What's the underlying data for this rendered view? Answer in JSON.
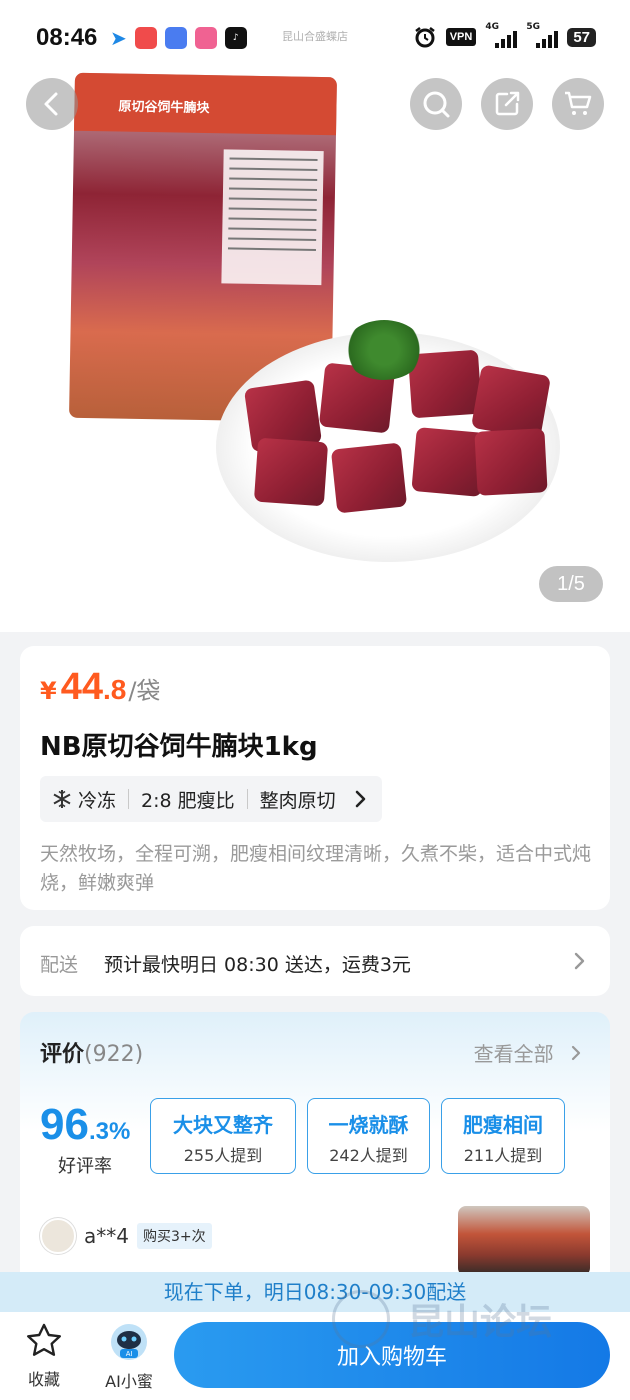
{
  "status_bar": {
    "time": "08:46",
    "carrier_text": "昆山合盛蝶店",
    "vpn": "VPN",
    "net1": "4G",
    "net2": "5G",
    "battery": "57"
  },
  "gallery": {
    "package_text": "原切谷饲牛腩块",
    "counter": "1/5"
  },
  "product": {
    "price_symbol": "¥",
    "price_int": "44",
    "price_dec": ".8",
    "price_unit": "/袋",
    "title": "NB原切谷饲牛腩块1kg",
    "tags": [
      "冷冻",
      "2:8 肥瘦比",
      "整肉原切"
    ],
    "description": "天然牧场，全程可溯，肥瘦相间纹理清晰，久煮不柴，适合中式炖烧，鲜嫩爽弹"
  },
  "delivery": {
    "label": "配送",
    "text": "预计最快明日 08:30 送达，运费3元"
  },
  "reviews": {
    "title": "评价",
    "count": "(922)",
    "view_all": "查看全部",
    "rate_big": "96",
    "rate_small": ".3%",
    "rate_label": "好评率",
    "chips": [
      {
        "title": "大块又整齐",
        "sub": "255人提到"
      },
      {
        "title": "一烧就酥",
        "sub": "242人提到"
      },
      {
        "title": "肥瘦相间",
        "sub": "211人提到"
      }
    ],
    "reviewer_name": "a**4",
    "reviewer_badge": "购买3+次"
  },
  "banner": "现在下单，明日08:30-09:30配送",
  "bottom_bar": {
    "favorite": "收藏",
    "ai": "AI小蜜",
    "ai_badge": "AI",
    "add_to_cart": "加入购物车"
  },
  "watermark": "昆山论坛",
  "colors": {
    "price": "#ff5a1f",
    "accent": "#1a8fe8",
    "button": "#1479e6",
    "banner_bg": "#d4ebf8"
  },
  "icons": [
    "back-icon",
    "search-icon",
    "share-icon",
    "cart-icon",
    "snowflake-icon",
    "chevron-right-icon",
    "star-icon",
    "ai-avatar-icon"
  ]
}
